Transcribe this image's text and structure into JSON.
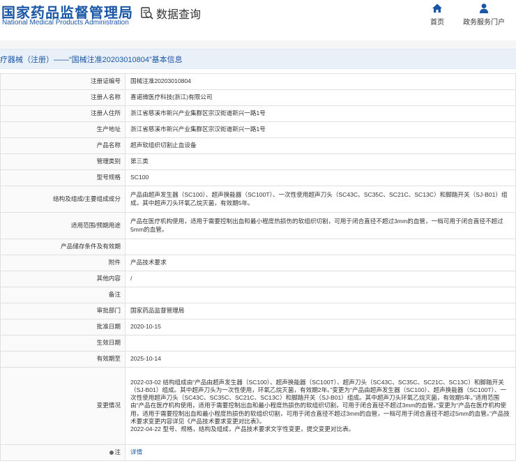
{
  "header": {
    "logo_cn": "国家药品监督管理局",
    "logo_en": "National Medical Products Administration",
    "section_label": "数据查询",
    "nav": [
      {
        "label": "首页",
        "icon": "home-icon"
      },
      {
        "label": "政务服务门户",
        "icon": "user-icon"
      }
    ]
  },
  "title": "疗器械（注册）——“国械注准20203010804”基本信息",
  "rows": [
    {
      "label": "注册证编号",
      "value": "国械注准20203010804"
    },
    {
      "label": "注册人名称",
      "value": "喜诺微医疗科技(浙江)有限公司"
    },
    {
      "label": "注册人住所",
      "value": "浙江省慈溪市新兴产业集群区宗汉街道新兴一路1号"
    },
    {
      "label": "生产地址",
      "value": "浙江省慈溪市新兴产业集群区宗汉街道新兴一路1号"
    },
    {
      "label": "产品名称",
      "value": "超声软组织切割止血设备"
    },
    {
      "label": "管理类别",
      "value": "第三类"
    },
    {
      "label": "型号规格",
      "value": "SC100"
    },
    {
      "label": "结构及组成/主要组成成分",
      "value": "产品由超声发生器（SC100）、超声换能器（SC100T）、一次性使用超声刀头（SC43C、SC35C、SC21C、SC13C）和脚踏开关（SJ-B01）组成。其中超声刀头环氧乙烷灭菌，有效期5年。"
    },
    {
      "label": "适用范围/预期用途",
      "value": "产品在医疗机构使用，适用于需要控制出血和最小程度热损伤的软组织切割，可用于闭合直径不超过3mm的血管，一档可用于闭合直径不超过5mm的血管。"
    },
    {
      "label": "产品储存条件及有效期",
      "value": ""
    },
    {
      "label": "附件",
      "value": "产品技术要求"
    },
    {
      "label": "其他内容",
      "value": "/"
    },
    {
      "label": "备注",
      "value": ""
    },
    {
      "label": "审批部门",
      "value": "国家药品监督管理局"
    },
    {
      "label": "批准日期",
      "value": "2020-10-15"
    },
    {
      "label": "生效日期",
      "value": ""
    },
    {
      "label": "有效期至",
      "value": "2025-10-14"
    },
    {
      "label": "变更情况",
      "value": "2022-03-02 结构组成由“产品由超声发生器（SC100）、超声换能器（SC100T）、超声刀头（SC43C、SC35C、SC21C、SC13C）和脚踏开关（SJ-B01）组成。其中超声刀头为一次性使用，环氧乙烷灭菌，有效期2年。”变更为“产品由超声发生器（SC100）、超声换能器（SC100T）、一次性使用超声刀头（SC43C、SC35C、SC21C、SC13C）和脚踏开关（SJ-B01）组成。其中超声刀头环氧乙烷灭菌，有效期5年。”适用范围由“产品在医疗机构使用，适用于需要控制出血和最小程度热损伤的软组织切割，可用于闭合直径不超过3mm的血管。”变更为“产品在医疗机构使用，适用于需要控制出血和最小程度热损伤的软组织切割，可用于闭合直径不超过3mm的血管，一档可用于闭合直径不超过5mm的血管。”产品技术要求变更内容详见《产品技术要求变更对比表》。",
      "value2": "2022-04-22 型号、规格，结构及组成，产品技术要求文字性变更，提交变更对比表。"
    },
    {
      "label": "注",
      "value": "详情"
    }
  ]
}
